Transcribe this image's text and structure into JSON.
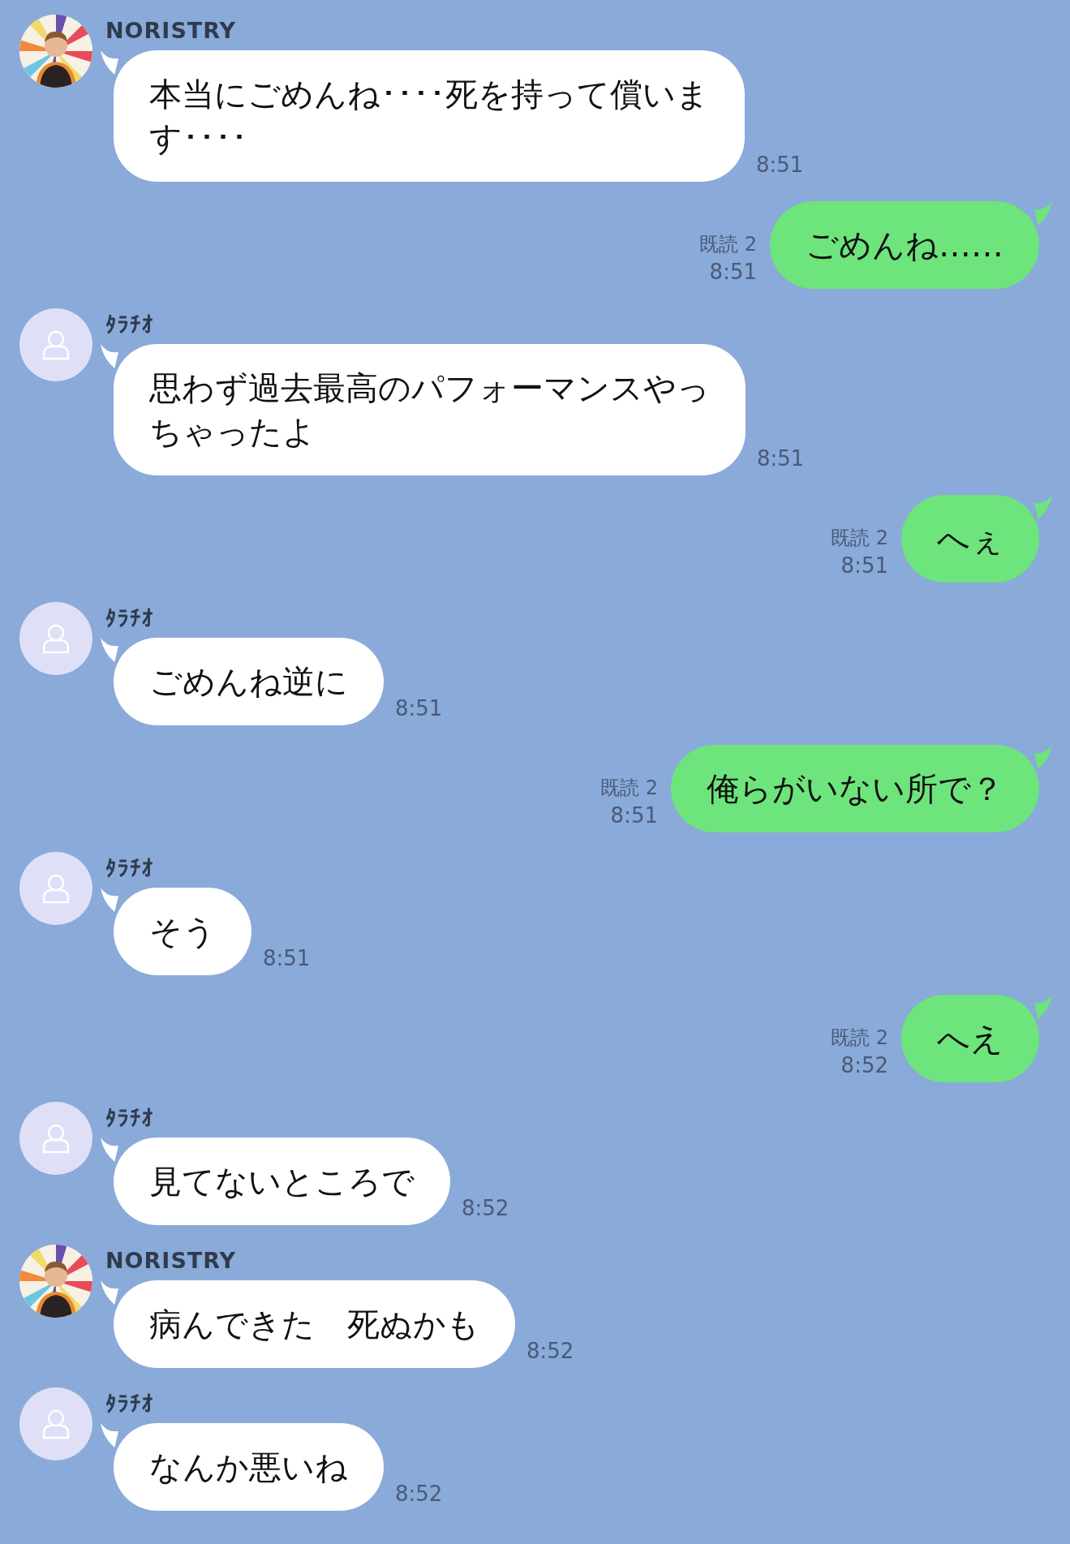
{
  "messages": [
    {
      "kind": "incoming",
      "sender": "NORISTRY",
      "avatar": {
        "kind": "picture"
      },
      "lines": [
        "本当にごめんね････死を持って償いま",
        "す････"
      ],
      "time": "8:51"
    },
    {
      "kind": "outgoing",
      "read": "既読 2",
      "lines": [
        "ごめんね……"
      ],
      "time": "8:51"
    },
    {
      "kind": "incoming",
      "sender": "ﾀﾗﾁｵ",
      "avatar": {
        "kind": "default"
      },
      "lines": [
        "思わず過去最高のパフォーマンスやっ",
        "ちゃったよ"
      ],
      "time": "8:51"
    },
    {
      "kind": "outgoing",
      "read": "既読 2",
      "lines": [
        "へぇ"
      ],
      "time": "8:51"
    },
    {
      "kind": "incoming",
      "sender": "ﾀﾗﾁｵ",
      "avatar": {
        "kind": "default"
      },
      "lines": [
        "ごめんね逆に"
      ],
      "time": "8:51"
    },
    {
      "kind": "outgoing",
      "read": "既読 2",
      "lines": [
        "俺らがいない所で？"
      ],
      "time": "8:51"
    },
    {
      "kind": "incoming",
      "sender": "ﾀﾗﾁｵ",
      "avatar": {
        "kind": "default"
      },
      "lines": [
        "そう"
      ],
      "time": "8:51"
    },
    {
      "kind": "outgoing",
      "read": "既読 2",
      "lines": [
        "へえ"
      ],
      "time": "8:52"
    },
    {
      "kind": "incoming",
      "sender": "ﾀﾗﾁｵ",
      "avatar": {
        "kind": "default"
      },
      "lines": [
        "見てないところで"
      ],
      "time": "8:52"
    },
    {
      "kind": "incoming",
      "sender": "NORISTRY",
      "avatar": {
        "kind": "picture"
      },
      "lines": [
        "病んできた　死ぬかも"
      ],
      "time": "8:52"
    },
    {
      "kind": "incoming",
      "sender": "ﾀﾗﾁｵ",
      "avatar": {
        "kind": "default"
      },
      "lines": [
        "なんか悪いね"
      ],
      "time": "8:52"
    }
  ]
}
